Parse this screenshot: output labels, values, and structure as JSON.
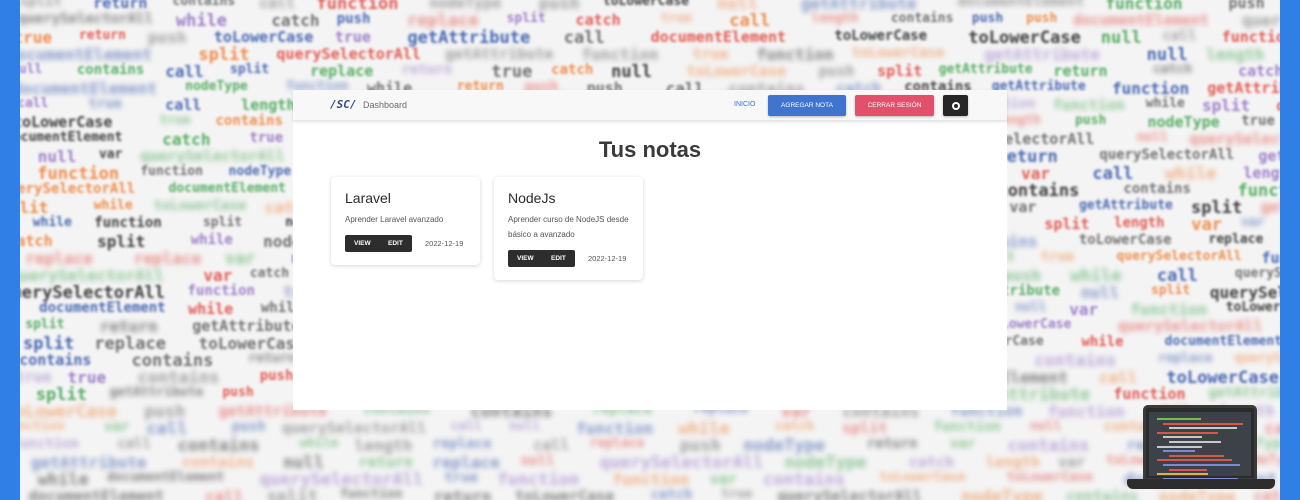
{
  "navbar": {
    "brand": "/SC/",
    "dashboard_label": "Dashboard",
    "inicio_label": "INICIO",
    "add_note_label": "AGREGAR NOTA",
    "logout_label": "CERRAR SESIÓN",
    "github_icon": "github-icon"
  },
  "page": {
    "title": "Tus notas"
  },
  "notes": [
    {
      "title": "Laravel",
      "body": "Aprender Laravel avanzado",
      "view_label": "VIEW",
      "edit_label": "EDIT",
      "date": "2022-12-19"
    },
    {
      "title": "NodeJs",
      "body": "Aprender curso de NodeJS desde básico a avanzado",
      "view_label": "VIEW",
      "edit_label": "EDIT",
      "date": "2022-12-19"
    }
  ],
  "colors": {
    "frame": "#2f7fe6",
    "primary": "#3f74cf",
    "danger": "#e2506b",
    "dark": "#262626"
  }
}
